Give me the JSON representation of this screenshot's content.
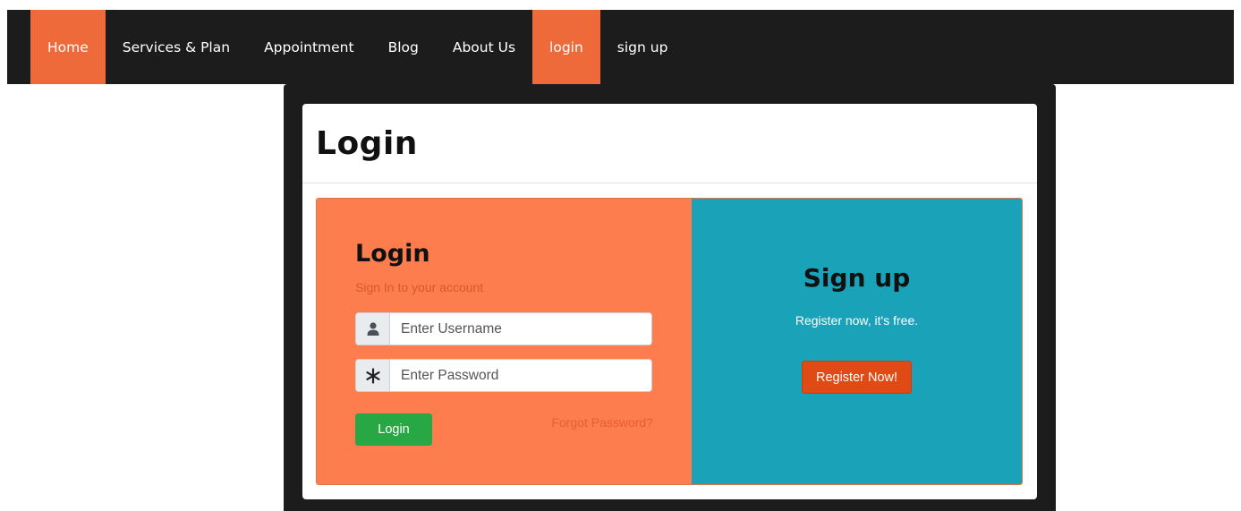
{
  "nav": {
    "items": [
      {
        "label": "Home",
        "active": true
      },
      {
        "label": "Services & Plan",
        "active": false
      },
      {
        "label": "Appointment",
        "active": false
      },
      {
        "label": "Blog",
        "active": false
      },
      {
        "label": "About Us",
        "active": false
      },
      {
        "label": "login",
        "active": true
      },
      {
        "label": "sign up",
        "active": false
      }
    ]
  },
  "card": {
    "title": "Login"
  },
  "login_panel": {
    "title": "Login",
    "subtitle": "Sign In to your account",
    "username_placeholder": "Enter Username",
    "password_placeholder": "Enter Password",
    "username_icon": "user-icon",
    "password_icon": "asterisk-icon",
    "login_button": "Login",
    "forgot_link": "Forgot Password?"
  },
  "signup_panel": {
    "title": "Sign up",
    "text": "Register now, it's free.",
    "register_button": "Register Now!"
  },
  "colors": {
    "nav_bg": "#1c1c1c",
    "nav_active": "#ee6a3a",
    "login_panel_bg": "#fe7d4f",
    "signup_panel_bg": "#19a2b8",
    "login_button": "#28a745",
    "register_button": "#e04b15"
  }
}
